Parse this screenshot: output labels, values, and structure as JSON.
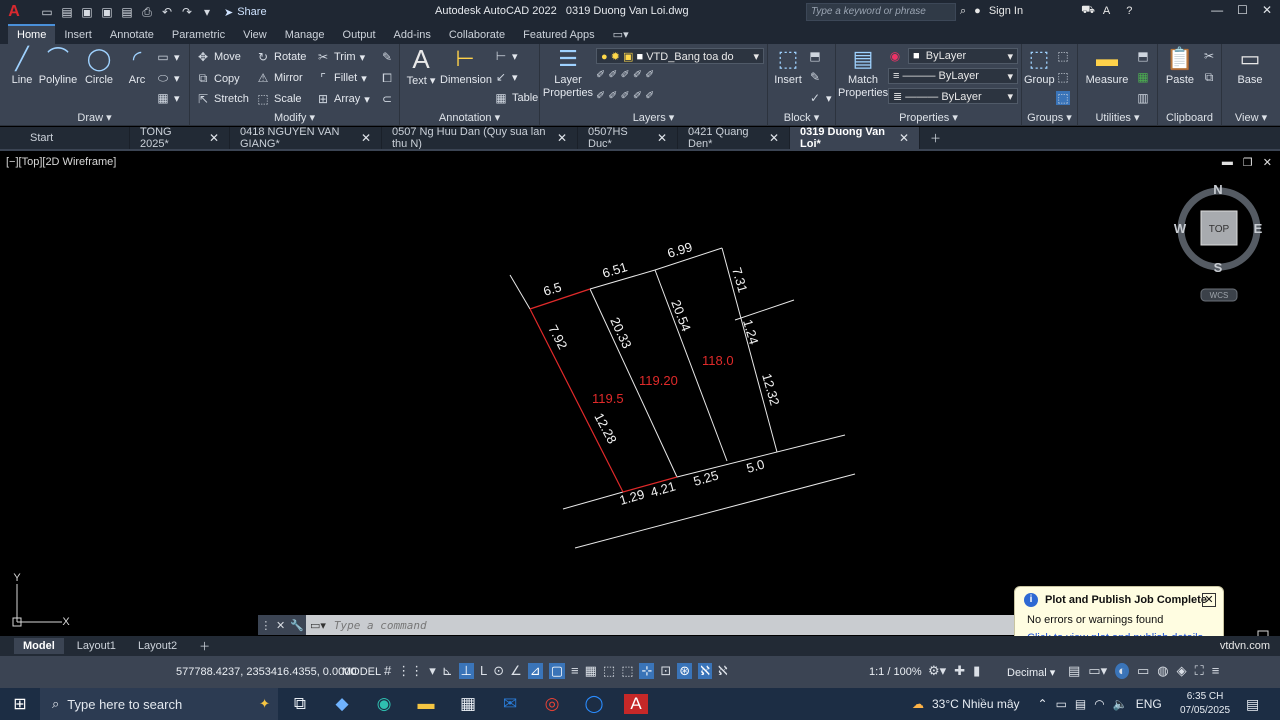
{
  "app": {
    "title": "Autodesk AutoCAD 2022",
    "filename": "0319 Duong Van Loi.dwg",
    "share_label": "Share",
    "search_placeholder": "Type a keyword or phrase",
    "sign_in": "Sign In"
  },
  "ribbon_tabs": [
    "Home",
    "Insert",
    "Annotate",
    "Parametric",
    "View",
    "Manage",
    "Output",
    "Add-ins",
    "Collaborate",
    "Featured Apps"
  ],
  "ribbon": {
    "draw": {
      "title": "Draw",
      "line": "Line",
      "polyline": "Polyline",
      "circle": "Circle",
      "arc": "Arc"
    },
    "modify": {
      "title": "Modify",
      "move": "Move",
      "rotate": "Rotate",
      "trim": "Trim",
      "copy": "Copy",
      "mirror": "Mirror",
      "fillet": "Fillet",
      "stretch": "Stretch",
      "scale": "Scale",
      "array": "Array"
    },
    "annotation": {
      "title": "Annotation",
      "text": "Text",
      "dimension": "Dimension",
      "table": "Table"
    },
    "layers": {
      "title": "Layers",
      "layer_properties": "Layer Properties",
      "current_layer": "VTD_Bang toa do"
    },
    "block": {
      "title": "Block",
      "insert": "Insert"
    },
    "properties": {
      "title": "Properties",
      "match": "Match Properties",
      "color": "ByLayer",
      "linetype": "ByLayer",
      "lineweight": "ByLayer"
    },
    "groups": {
      "title": "Groups",
      "group": "Group"
    },
    "utilities": {
      "title": "Utilities",
      "measure": "Measure"
    },
    "clipboard": {
      "title": "Clipboard",
      "paste": "Paste"
    },
    "view": {
      "title": "View",
      "base": "Base"
    }
  },
  "doc_tabs": [
    {
      "label": "Start",
      "closable": false,
      "active": false
    },
    {
      "label": "TONG 2025*",
      "closable": true,
      "active": false
    },
    {
      "label": "0418 NGUYEN VAN GIANG*",
      "closable": true,
      "active": false
    },
    {
      "label": "0507 Ng Huu Dan (Quy sua lan thu N)",
      "closable": true,
      "active": false
    },
    {
      "label": "0507HS Duc*",
      "closable": true,
      "active": false
    },
    {
      "label": "0421 Quang Den*",
      "closable": true,
      "active": false
    },
    {
      "label": "0319 Duong Van Loi*",
      "closable": true,
      "active": true
    }
  ],
  "viewport": {
    "label": "[−][Top][2D Wireframe]",
    "viewcube": {
      "n": "N",
      "s": "S",
      "e": "E",
      "w": "W",
      "face": "TOP",
      "wcs": "WCS"
    },
    "ucs": {
      "x": "X",
      "y": "Y"
    }
  },
  "drawing": {
    "dims": {
      "d1": "6.5",
      "d2": "6.51",
      "d3": "6.99",
      "d4": "7.31",
      "d5": "7.92",
      "d6": "20.33",
      "d7": "20.54",
      "d8": "1.24",
      "d9": "12.32",
      "d10": "12.28",
      "d11": "1.29",
      "d12": "4.21",
      "d13": "5.25",
      "d14": "5.0"
    },
    "areas": {
      "a1": "119.5",
      "a2": "119.20",
      "a3": "118.0"
    }
  },
  "command": {
    "placeholder": "Type a command"
  },
  "notification": {
    "title": "Plot and Publish Job Complete",
    "message": "No errors or warnings found",
    "link": "Click to view plot and publish details..."
  },
  "layout_tabs": [
    "Model",
    "Layout1",
    "Layout2"
  ],
  "website": "vtdvn.com",
  "status": {
    "coords": "577788.4237, 2353416.4355, 0.0000",
    "model": "MODEL",
    "scale": "1:1 / 100%",
    "units": "Decimal"
  },
  "taskbar": {
    "search": "Type here to search",
    "weather": "33°C  Nhiều mây",
    "lang": "ENG",
    "time": "6:35 CH",
    "date": "07/05/2025"
  }
}
